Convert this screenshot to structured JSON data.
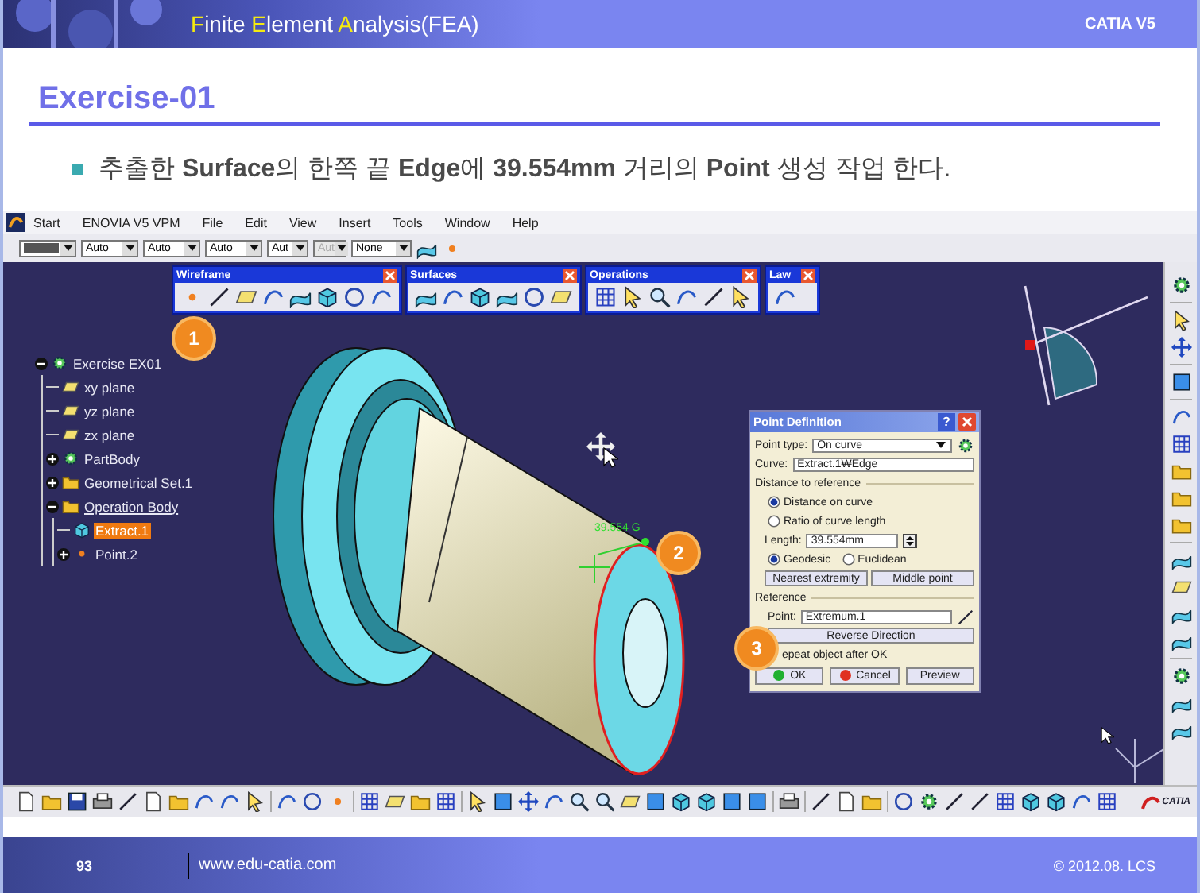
{
  "header": {
    "title_parts": [
      {
        "text": "F",
        "highlight": true
      },
      {
        "text": "inite ",
        "highlight": false
      },
      {
        "text": "E",
        "highlight": true
      },
      {
        "text": "lement ",
        "highlight": false
      },
      {
        "text": "A",
        "highlight": true
      },
      {
        "text": "nalysis(FEA)",
        "highlight": false
      }
    ],
    "product": "CATIA V5"
  },
  "slide_title": "Exercise-01",
  "bullet": "추출한 **Surface**의 한쪽 끝 **Edge**에 **39.554mm** 거리의 **Point** 생성 작업 한다.",
  "app": {
    "menu": [
      "Start",
      "ENOVIA V5 VPM",
      "File",
      "Edit",
      "View",
      "Insert",
      "Tools",
      "Window",
      "Help"
    ],
    "combos": [
      {
        "kind": "swatch"
      },
      {
        "kind": "text",
        "value": "Auto",
        "disabled": false
      },
      {
        "kind": "text",
        "value": "Auto",
        "disabled": false
      },
      {
        "kind": "text",
        "value": "Auto",
        "disabled": false
      },
      {
        "kind": "text",
        "value": "Aut",
        "disabled": false
      },
      {
        "kind": "text",
        "value": "Aut",
        "disabled": true
      },
      {
        "kind": "text",
        "value": "None",
        "disabled": false
      }
    ],
    "toolbars": [
      {
        "title": "Wireframe"
      },
      {
        "title": "Surfaces"
      },
      {
        "title": "Operations"
      },
      {
        "title": "Law"
      }
    ],
    "tree": [
      {
        "label": "Exercise EX01",
        "kind": "part",
        "expanded": true,
        "selected": false,
        "current": false,
        "children": [
          {
            "label": "xy plane",
            "kind": "plane",
            "selected": false,
            "current": false
          },
          {
            "label": "yz plane",
            "kind": "plane",
            "selected": false,
            "current": false
          },
          {
            "label": "zx plane",
            "kind": "plane",
            "selected": false,
            "current": false
          },
          {
            "label": "PartBody",
            "kind": "body",
            "expanded": false,
            "selected": false,
            "current": false
          },
          {
            "label": "Geometrical Set.1",
            "kind": "set",
            "expanded": false,
            "selected": false,
            "current": false
          },
          {
            "label": "Operation Body",
            "kind": "set",
            "expanded": true,
            "selected": false,
            "current": true,
            "children": [
              {
                "label": "Extract.1",
                "kind": "feature",
                "selected": true,
                "current": false
              },
              {
                "label": "Point.2",
                "kind": "point",
                "expanded": false,
                "selected": false,
                "current": false
              }
            ]
          }
        ]
      }
    ],
    "callouts": [
      "1",
      "2",
      "3"
    ],
    "dimension": "39.554 G",
    "dialog": {
      "title": "Point Definition",
      "help": "?",
      "point_type_label": "Point type:",
      "point_type": "On curve",
      "curve_label": "Curve:",
      "curve": "Extract.1₩Edge",
      "group1": "Distance to reference",
      "radios1": [
        {
          "label": "Distance on curve",
          "selected": true
        },
        {
          "label": "Ratio of curve length",
          "selected": false
        }
      ],
      "length_label": "Length:",
      "length": "39.554mm",
      "radios2": [
        {
          "label": "Geodesic",
          "selected": true
        },
        {
          "label": "Euclidean",
          "selected": false
        }
      ],
      "buttons": [
        "Nearest extremity",
        "Middle point"
      ],
      "group2": "Reference",
      "point_label": "Point:",
      "point": "Extremum.1",
      "reverse": "Reverse Direction",
      "repeat": "epeat object after OK",
      "actions": [
        {
          "label": "OK",
          "kind": "ok"
        },
        {
          "label": "Cancel",
          "kind": "cancel"
        },
        {
          "label": "Preview",
          "kind": "plain"
        }
      ]
    },
    "logo": "CATIA"
  },
  "footer": {
    "page": "93",
    "url": "www.edu-catia.com",
    "copyright": "© 2012.08. LCS"
  }
}
